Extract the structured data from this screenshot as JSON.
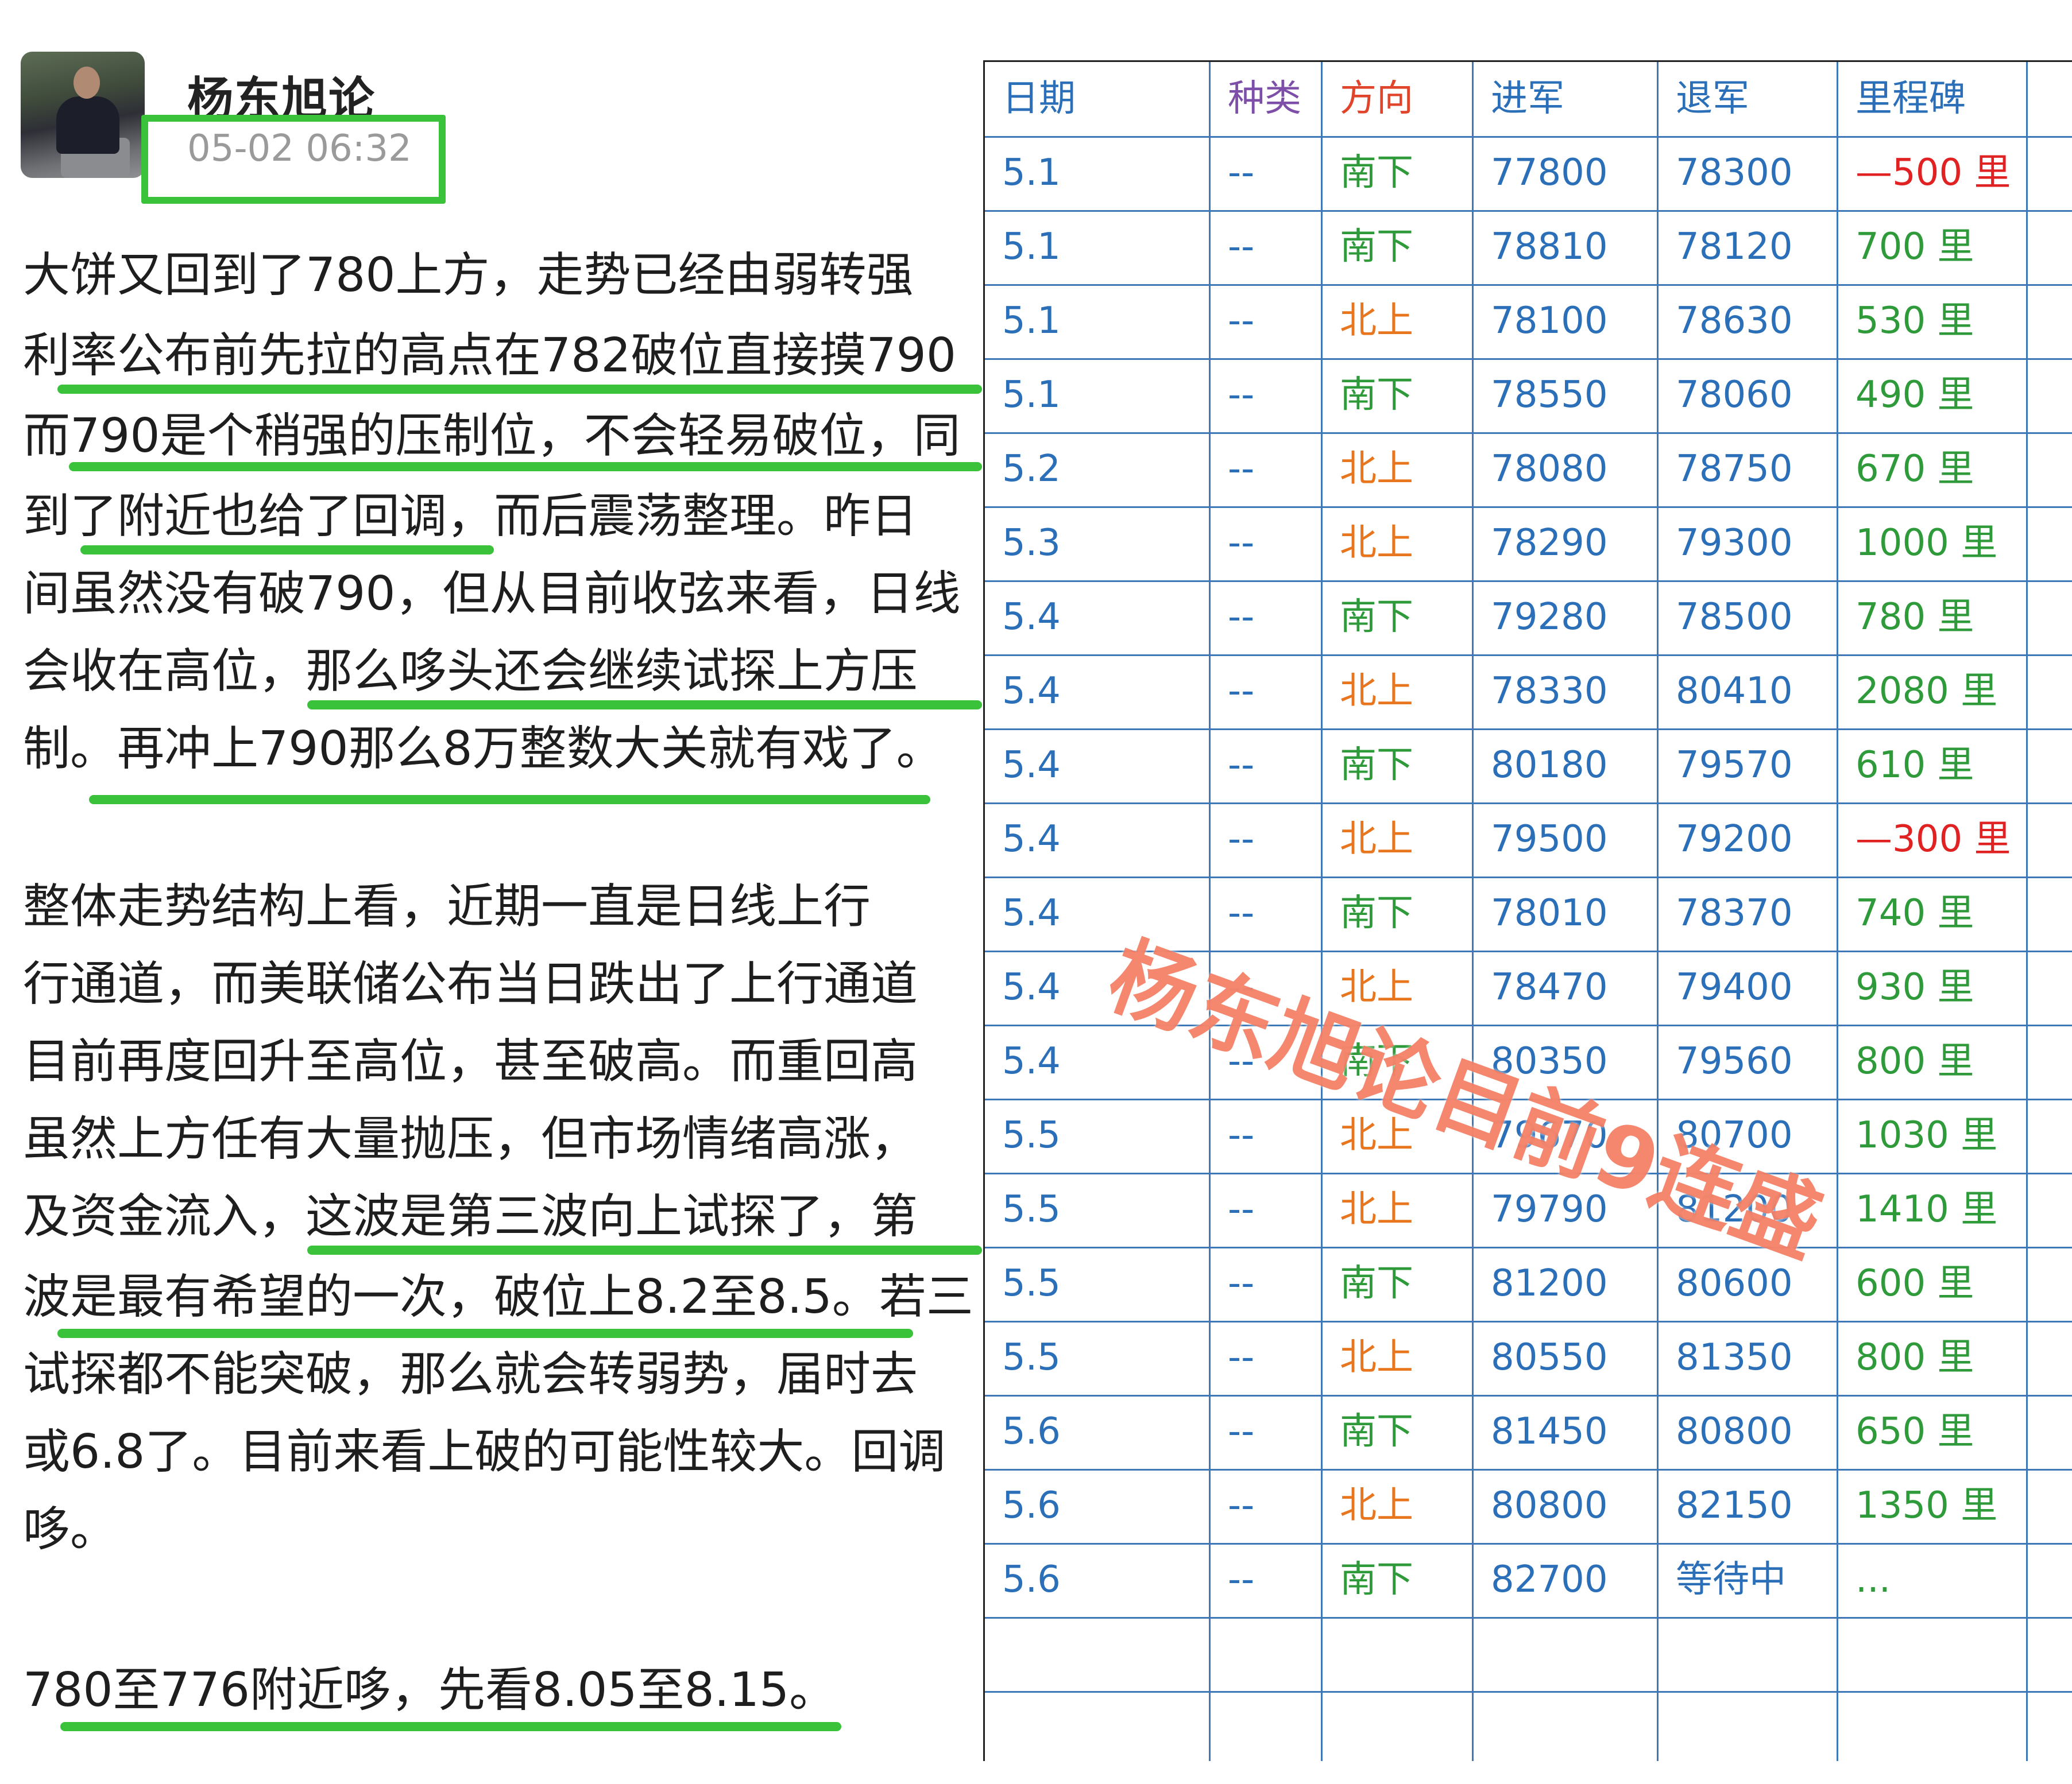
{
  "post": {
    "author": "杨东旭论",
    "timestamp": "05-02 06:32",
    "paragraphs": [
      [
        "大饼又回到了780上方，走势已经由弱转强",
        "利率公布前先拉的高点在782破位直接摸790",
        "而790是个稍强的压制位，不会轻易破位，同",
        "到了附近也给了回调，而后震荡整理。昨日",
        "间虽然没有破790，但从目前收弦来看，日线",
        "会收在高位，那么哆头还会继续试探上方压",
        "制。再冲上790那么8万整数大关就有戏了。"
      ],
      [
        "整体走势结构上看，近期一直是日线上行",
        "行通道，而美联储公布当日跌出了上行通道",
        "目前再度回升至高位，甚至破高。而重回高",
        "虽然上方任有大量抛压，但市场情绪高涨，",
        "及资金流入，这波是第三波向上试探了，第",
        "波是最有希望的一次，破位上8.2至8.5。若三",
        "试探都不能突破，那么就会转弱势，届时去",
        "或6.8了。目前来看上破的可能性较大。回调",
        "哆。"
      ],
      [
        "780至776附近哆，先看8.05至8.15。"
      ]
    ]
  },
  "table": {
    "headers": [
      "日期",
      "种类",
      "方向",
      "进军",
      "退军",
      "里程碑"
    ],
    "rows": [
      {
        "date": "5.1",
        "kind": "--",
        "dir": "南下",
        "entry": "77800",
        "exit": "78300",
        "mile": "—500 里"
      },
      {
        "date": "5.1",
        "kind": "--",
        "dir": "南下",
        "entry": "78810",
        "exit": "78120",
        "mile": "700 里"
      },
      {
        "date": "5.1",
        "kind": "--",
        "dir": "北上",
        "entry": "78100",
        "exit": "78630",
        "mile": "530 里"
      },
      {
        "date": "5.1",
        "kind": "--",
        "dir": "南下",
        "entry": "78550",
        "exit": "78060",
        "mile": "490 里"
      },
      {
        "date": "5.2",
        "kind": "--",
        "dir": "北上",
        "entry": "78080",
        "exit": "78750",
        "mile": "670 里"
      },
      {
        "date": "5.3",
        "kind": "--",
        "dir": "北上",
        "entry": "78290",
        "exit": "79300",
        "mile": "1000 里"
      },
      {
        "date": "5.4",
        "kind": "--",
        "dir": "南下",
        "entry": "79280",
        "exit": "78500",
        "mile": "780 里"
      },
      {
        "date": "5.4",
        "kind": "--",
        "dir": "北上",
        "entry": "78330",
        "exit": "80410",
        "mile": "2080 里"
      },
      {
        "date": "5.4",
        "kind": "--",
        "dir": "南下",
        "entry": "80180",
        "exit": "79570",
        "mile": "610 里"
      },
      {
        "date": "5.4",
        "kind": "--",
        "dir": "北上",
        "entry": "79500",
        "exit": "79200",
        "mile": "—300 里"
      },
      {
        "date": "5.4",
        "kind": "--",
        "dir": "南下",
        "entry": "78010",
        "exit": "78370",
        "mile": "740 里"
      },
      {
        "date": "5.4",
        "kind": "--",
        "dir": "北上",
        "entry": "78470",
        "exit": "79400",
        "mile": "930 里"
      },
      {
        "date": "5.4",
        "kind": "--",
        "dir": "南下",
        "entry": "80350",
        "exit": "79560",
        "mile": "800 里"
      },
      {
        "date": "5.5",
        "kind": "--",
        "dir": "北上",
        "entry": "79670",
        "exit": "80700",
        "mile": "1030 里"
      },
      {
        "date": "5.5",
        "kind": "--",
        "dir": "北上",
        "entry": "79790",
        "exit": "81200",
        "mile": "1410 里"
      },
      {
        "date": "5.5",
        "kind": "--",
        "dir": "南下",
        "entry": "81200",
        "exit": "80600",
        "mile": "600 里"
      },
      {
        "date": "5.5",
        "kind": "--",
        "dir": "北上",
        "entry": "80550",
        "exit": "81350",
        "mile": "800 里"
      },
      {
        "date": "5.6",
        "kind": "--",
        "dir": "南下",
        "entry": "81450",
        "exit": "80800",
        "mile": "650 里"
      },
      {
        "date": "5.6",
        "kind": "--",
        "dir": "北上",
        "entry": "80800",
        "exit": "82150",
        "mile": "1350 里"
      },
      {
        "date": "5.6",
        "kind": "--",
        "dir": "南下",
        "entry": "82700",
        "exit": "等待中",
        "mile": "..."
      },
      {
        "date": "",
        "kind": "",
        "dir": "",
        "entry": "",
        "exit": "",
        "mile": ""
      },
      {
        "date": "",
        "kind": "",
        "dir": "",
        "entry": "",
        "exit": "",
        "mile": ""
      }
    ],
    "colors": {
      "header_blue": "#2b6fb8",
      "header_dir": "#e0442a",
      "header_kind": "#7d4fa8",
      "text_blue": "#2b6fb8",
      "south": "#2e9a3a",
      "north": "#e8761e",
      "mile_positive": "#2e9a3a",
      "mile_negative": "#e02222"
    }
  },
  "watermark": "杨东旭论目前9连盛",
  "highlight_color": "#3bc23b"
}
